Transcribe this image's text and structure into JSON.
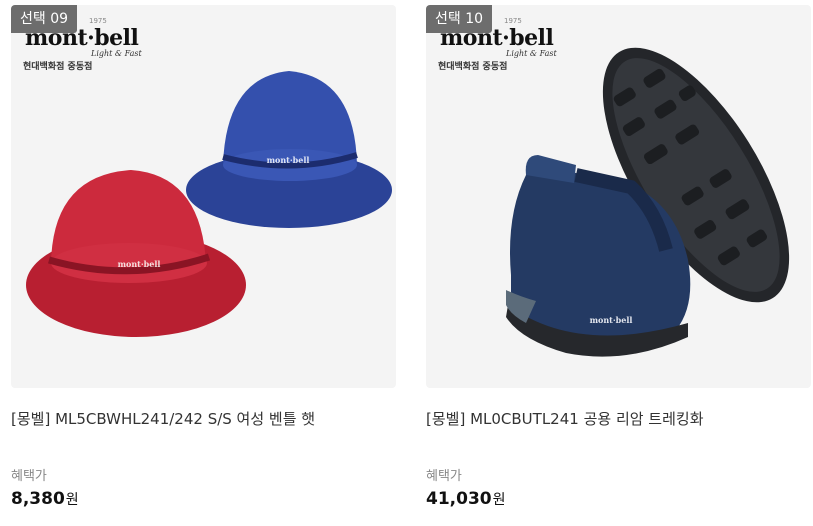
{
  "products": [
    {
      "badge": "선택 09",
      "logo": {
        "est": "1975",
        "brand": "mont·bell",
        "tagline": "Light & Fast",
        "store": "현대백화점 중동점"
      },
      "name": "[몽벨] ML5CBWHL241/242 S/S 여성 벤틀 햇",
      "benefit_label": "혜택가",
      "price": "8,380",
      "currency": "원",
      "image_colors": {
        "hat_front": "#c8263a",
        "hat_back": "#2f4aa6"
      }
    },
    {
      "badge": "선택 10",
      "logo": {
        "est": "1975",
        "brand": "mont·bell",
        "tagline": "Light & Fast",
        "store": "현대백화점 중동점"
      },
      "name": "[몽벨] ML0CBUTL241 공용 리암 트레킹화",
      "benefit_label": "혜택가",
      "price": "41,030",
      "currency": "원",
      "image_colors": {
        "shoe_upper": "#243a63",
        "sole": "#2a2c30"
      }
    }
  ]
}
